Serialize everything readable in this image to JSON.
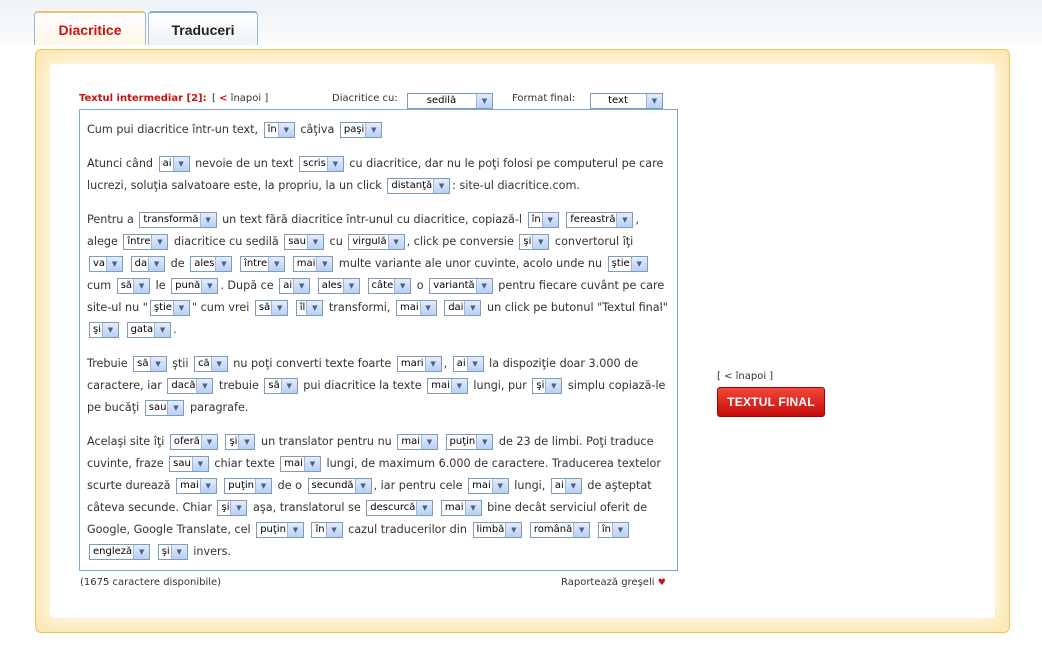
{
  "tabs": [
    {
      "label": "Diacritice",
      "active": true
    },
    {
      "label": "Traduceri",
      "active": false
    }
  ],
  "header": {
    "title": "Textul intermediar [2]:",
    "back_open": "[",
    "back_chevron": "<",
    "back_label": "înapoi",
    "back_close": "]",
    "diacritics_label": "Diacritice cu:",
    "diacritics_value": "sedilă",
    "format_label": "Format final:",
    "format_value": "text"
  },
  "colors": {
    "accent": "#cc1111",
    "panel_border": "#f0c45a",
    "textbox_border": "#7fa9d6",
    "button": "#d9221b"
  },
  "paragraphs": [
    [
      {
        "t": "Cum pui diacritice într-un text, "
      },
      {
        "s": "în"
      },
      {
        "t": " câţiva "
      },
      {
        "s": "paşi"
      }
    ],
    [
      {
        "t": "Atunci când "
      },
      {
        "s": "ai"
      },
      {
        "t": " nevoie de un text "
      },
      {
        "s": "scris"
      },
      {
        "t": " cu diacritice, dar nu le poţi folosi pe computerul pe care lucrezi, soluţia salvatoare este, la propriu, la un click "
      },
      {
        "s": "distanţă"
      },
      {
        "t": ": site-ul diacritice.com."
      }
    ],
    [
      {
        "t": "Pentru a "
      },
      {
        "s": "transformă"
      },
      {
        "t": " un text fără diacritice într-unul cu diacritice, copiază-l "
      },
      {
        "s": "în"
      },
      {
        "t": " "
      },
      {
        "s": "fereastră"
      },
      {
        "t": ", alege "
      },
      {
        "s": "între"
      },
      {
        "t": " diacritice cu sedilă "
      },
      {
        "s": "sau"
      },
      {
        "t": " cu "
      },
      {
        "s": "virgulă"
      },
      {
        "t": ", click pe conversie "
      },
      {
        "s": "şi"
      },
      {
        "t": " convertorul îţi "
      },
      {
        "s": "va"
      },
      {
        "t": " "
      },
      {
        "s": "da"
      },
      {
        "t": " de "
      },
      {
        "s": "ales"
      },
      {
        "t": " "
      },
      {
        "s": "între"
      },
      {
        "t": " "
      },
      {
        "s": "mai"
      },
      {
        "t": " multe variante ale unor cuvinte, acolo unde nu "
      },
      {
        "s": "ştie"
      },
      {
        "t": " cum "
      },
      {
        "s": "să"
      },
      {
        "t": " le "
      },
      {
        "s": "pună"
      },
      {
        "t": ". După ce "
      },
      {
        "s": "ai"
      },
      {
        "t": " "
      },
      {
        "s": "ales"
      },
      {
        "t": " "
      },
      {
        "s": "câte"
      },
      {
        "t": " o "
      },
      {
        "s": "variantă"
      },
      {
        "t": " pentru fiecare cuvânt pe care site-ul nu \""
      },
      {
        "s": "ştie"
      },
      {
        "t": "\" cum vrei "
      },
      {
        "s": "să"
      },
      {
        "t": " "
      },
      {
        "s": "îl"
      },
      {
        "t": " transformi, "
      },
      {
        "s": "mai"
      },
      {
        "t": " "
      },
      {
        "s": "dai"
      },
      {
        "t": " un click pe butonul \"Textul final\" "
      },
      {
        "s": "şi"
      },
      {
        "t": " "
      },
      {
        "s": "gata"
      },
      {
        "t": "."
      }
    ],
    [
      {
        "t": "Trebuie "
      },
      {
        "s": "să"
      },
      {
        "t": " ştii "
      },
      {
        "s": "că"
      },
      {
        "t": " nu poţi converti texte foarte "
      },
      {
        "s": "mari"
      },
      {
        "t": ", "
      },
      {
        "s": "ai"
      },
      {
        "t": " la dispoziţie doar 3.000 de caractere, iar "
      },
      {
        "s": "dacă"
      },
      {
        "t": " trebuie "
      },
      {
        "s": "să"
      },
      {
        "t": " pui diacritice la texte "
      },
      {
        "s": "mai"
      },
      {
        "t": " lungi, pur "
      },
      {
        "s": "şi"
      },
      {
        "t": " simplu copiază-le pe bucăţi "
      },
      {
        "s": "sau"
      },
      {
        "t": " paragrafe."
      }
    ],
    [
      {
        "t": "Acelaşi site îţi "
      },
      {
        "s": "oferă"
      },
      {
        "t": " "
      },
      {
        "s": "şi"
      },
      {
        "t": " un translator pentru nu "
      },
      {
        "s": "mai"
      },
      {
        "t": " "
      },
      {
        "s": "puţin"
      },
      {
        "t": " de 23 de limbi. Poţi traduce cuvinte, fraze "
      },
      {
        "s": "sau"
      },
      {
        "t": " chiar texte "
      },
      {
        "s": "mai"
      },
      {
        "t": " lungi, de maximum 6.000 de caractere. Traducerea textelor scurte durează "
      },
      {
        "s": "mai"
      },
      {
        "t": " "
      },
      {
        "s": "puţin"
      },
      {
        "t": " de o "
      },
      {
        "s": "secundă"
      },
      {
        "t": ", iar pentru cele "
      },
      {
        "s": "mai"
      },
      {
        "t": " lungi, "
      },
      {
        "s": "ai"
      },
      {
        "t": " de aşteptat câteva secunde. Chiar "
      },
      {
        "s": "şi"
      },
      {
        "t": " aşa, translatorul se "
      },
      {
        "s": "descurcă"
      },
      {
        "t": " "
      },
      {
        "s": "mai"
      },
      {
        "t": " bine decât serviciul oferit de Google, Google Translate, cel "
      },
      {
        "s": "puţin"
      },
      {
        "t": " "
      },
      {
        "s": "în"
      },
      {
        "t": " cazul traducerilor din "
      },
      {
        "s": "limbă"
      },
      {
        "t": " "
      },
      {
        "s": "română"
      },
      {
        "t": " "
      },
      {
        "s": "în"
      },
      {
        "t": " "
      },
      {
        "s": "engleză"
      },
      {
        "t": " "
      },
      {
        "s": "şi"
      },
      {
        "t": " invers."
      }
    ]
  ],
  "footer": {
    "chars_available": "(1675 caractere disponibile)",
    "report_label": "Raportează greşeli",
    "report_icon": "♥"
  },
  "side": {
    "back_label": "[ < înapoi ]",
    "final_button_label": "TEXTUL FINAL"
  }
}
